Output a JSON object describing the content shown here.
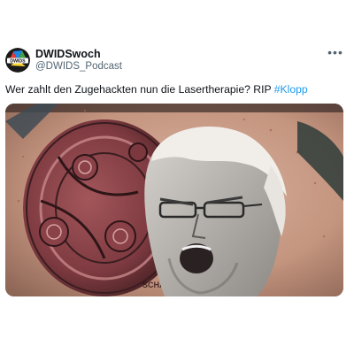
{
  "tweet": {
    "author": {
      "display_name": "DWIDSwoch",
      "handle": "@DWIDS_Podcast",
      "avatar_text": "DWIDS"
    },
    "more_menu_icon": "more-horizontal-icon",
    "text": "Wer zahlt den Zugehackten nun die Lasertherapie? RIP ",
    "hashtag": "#Klopp",
    "media": {
      "kind": "photo",
      "tattoo_lettering": "RSCHAFT · DEUTSCHER MEISTER"
    }
  },
  "colors": {
    "text_primary": "#0f1419",
    "text_secondary": "#536471",
    "link": "#1d9bf0",
    "avatar_bg": "#1a1a1a"
  }
}
